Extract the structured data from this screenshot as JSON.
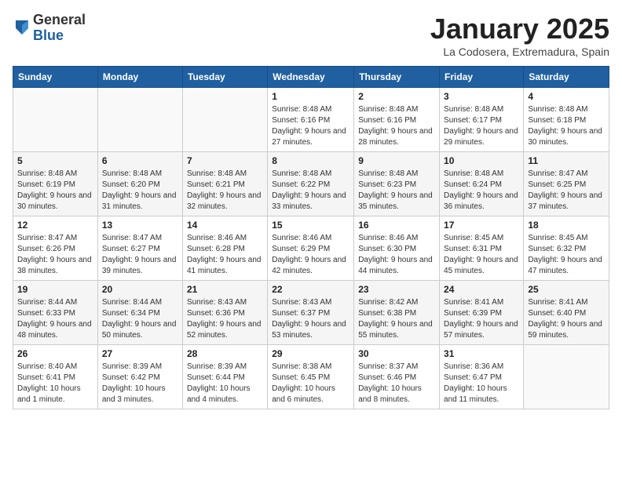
{
  "logo": {
    "general": "General",
    "blue": "Blue"
  },
  "title": "January 2025",
  "subtitle": "La Codosera, Extremadura, Spain",
  "days_of_week": [
    "Sunday",
    "Monday",
    "Tuesday",
    "Wednesday",
    "Thursday",
    "Friday",
    "Saturday"
  ],
  "weeks": [
    [
      {
        "day": "",
        "info": ""
      },
      {
        "day": "",
        "info": ""
      },
      {
        "day": "",
        "info": ""
      },
      {
        "day": "1",
        "info": "Sunrise: 8:48 AM\nSunset: 6:16 PM\nDaylight: 9 hours and 27 minutes."
      },
      {
        "day": "2",
        "info": "Sunrise: 8:48 AM\nSunset: 6:16 PM\nDaylight: 9 hours and 28 minutes."
      },
      {
        "day": "3",
        "info": "Sunrise: 8:48 AM\nSunset: 6:17 PM\nDaylight: 9 hours and 29 minutes."
      },
      {
        "day": "4",
        "info": "Sunrise: 8:48 AM\nSunset: 6:18 PM\nDaylight: 9 hours and 30 minutes."
      }
    ],
    [
      {
        "day": "5",
        "info": "Sunrise: 8:48 AM\nSunset: 6:19 PM\nDaylight: 9 hours and 30 minutes."
      },
      {
        "day": "6",
        "info": "Sunrise: 8:48 AM\nSunset: 6:20 PM\nDaylight: 9 hours and 31 minutes."
      },
      {
        "day": "7",
        "info": "Sunrise: 8:48 AM\nSunset: 6:21 PM\nDaylight: 9 hours and 32 minutes."
      },
      {
        "day": "8",
        "info": "Sunrise: 8:48 AM\nSunset: 6:22 PM\nDaylight: 9 hours and 33 minutes."
      },
      {
        "day": "9",
        "info": "Sunrise: 8:48 AM\nSunset: 6:23 PM\nDaylight: 9 hours and 35 minutes."
      },
      {
        "day": "10",
        "info": "Sunrise: 8:48 AM\nSunset: 6:24 PM\nDaylight: 9 hours and 36 minutes."
      },
      {
        "day": "11",
        "info": "Sunrise: 8:47 AM\nSunset: 6:25 PM\nDaylight: 9 hours and 37 minutes."
      }
    ],
    [
      {
        "day": "12",
        "info": "Sunrise: 8:47 AM\nSunset: 6:26 PM\nDaylight: 9 hours and 38 minutes."
      },
      {
        "day": "13",
        "info": "Sunrise: 8:47 AM\nSunset: 6:27 PM\nDaylight: 9 hours and 39 minutes."
      },
      {
        "day": "14",
        "info": "Sunrise: 8:46 AM\nSunset: 6:28 PM\nDaylight: 9 hours and 41 minutes."
      },
      {
        "day": "15",
        "info": "Sunrise: 8:46 AM\nSunset: 6:29 PM\nDaylight: 9 hours and 42 minutes."
      },
      {
        "day": "16",
        "info": "Sunrise: 8:46 AM\nSunset: 6:30 PM\nDaylight: 9 hours and 44 minutes."
      },
      {
        "day": "17",
        "info": "Sunrise: 8:45 AM\nSunset: 6:31 PM\nDaylight: 9 hours and 45 minutes."
      },
      {
        "day": "18",
        "info": "Sunrise: 8:45 AM\nSunset: 6:32 PM\nDaylight: 9 hours and 47 minutes."
      }
    ],
    [
      {
        "day": "19",
        "info": "Sunrise: 8:44 AM\nSunset: 6:33 PM\nDaylight: 9 hours and 48 minutes."
      },
      {
        "day": "20",
        "info": "Sunrise: 8:44 AM\nSunset: 6:34 PM\nDaylight: 9 hours and 50 minutes."
      },
      {
        "day": "21",
        "info": "Sunrise: 8:43 AM\nSunset: 6:36 PM\nDaylight: 9 hours and 52 minutes."
      },
      {
        "day": "22",
        "info": "Sunrise: 8:43 AM\nSunset: 6:37 PM\nDaylight: 9 hours and 53 minutes."
      },
      {
        "day": "23",
        "info": "Sunrise: 8:42 AM\nSunset: 6:38 PM\nDaylight: 9 hours and 55 minutes."
      },
      {
        "day": "24",
        "info": "Sunrise: 8:41 AM\nSunset: 6:39 PM\nDaylight: 9 hours and 57 minutes."
      },
      {
        "day": "25",
        "info": "Sunrise: 8:41 AM\nSunset: 6:40 PM\nDaylight: 9 hours and 59 minutes."
      }
    ],
    [
      {
        "day": "26",
        "info": "Sunrise: 8:40 AM\nSunset: 6:41 PM\nDaylight: 10 hours and 1 minute."
      },
      {
        "day": "27",
        "info": "Sunrise: 8:39 AM\nSunset: 6:42 PM\nDaylight: 10 hours and 3 minutes."
      },
      {
        "day": "28",
        "info": "Sunrise: 8:39 AM\nSunset: 6:44 PM\nDaylight: 10 hours and 4 minutes."
      },
      {
        "day": "29",
        "info": "Sunrise: 8:38 AM\nSunset: 6:45 PM\nDaylight: 10 hours and 6 minutes."
      },
      {
        "day": "30",
        "info": "Sunrise: 8:37 AM\nSunset: 6:46 PM\nDaylight: 10 hours and 8 minutes."
      },
      {
        "day": "31",
        "info": "Sunrise: 8:36 AM\nSunset: 6:47 PM\nDaylight: 10 hours and 11 minutes."
      },
      {
        "day": "",
        "info": ""
      }
    ]
  ]
}
